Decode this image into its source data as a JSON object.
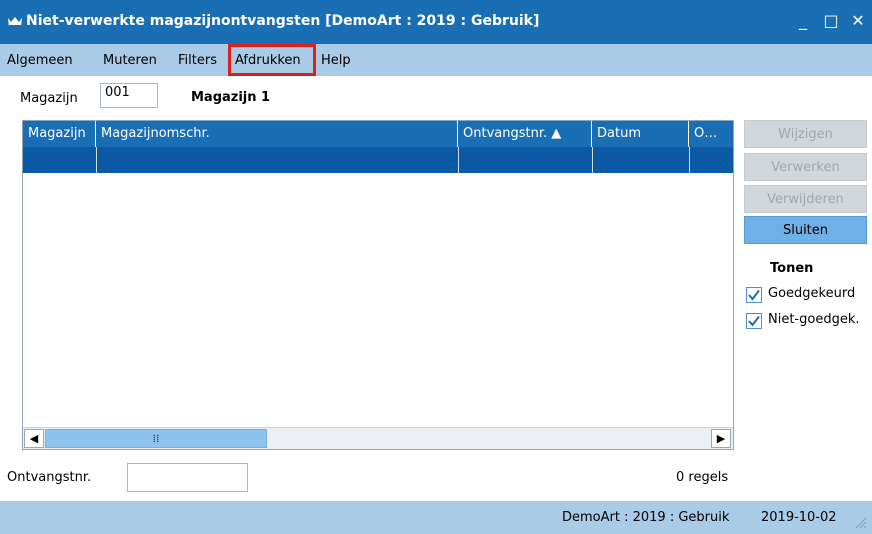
{
  "window": {
    "title": "Niet-verwerkte magazijnontvangsten  [DemoArt : 2019 : Gebruik]",
    "minimize": "_",
    "maximize": "□",
    "close": "✕"
  },
  "menu": {
    "items": [
      "Algemeen",
      "Muteren",
      "Filters",
      "Afdrukken",
      "Help"
    ],
    "highlighted": "Afdrukken"
  },
  "filter": {
    "magazijn_label": "Magazijn",
    "magazijn_value": "001",
    "magazijn_name": "Magazijn 1"
  },
  "grid": {
    "columns": [
      "Magazijn",
      "Magazijnomschr.",
      "Ontvangstnr. ▲",
      "Datum",
      "O…"
    ],
    "sort_column": "Ontvangstnr.",
    "rows": [
      [
        "",
        "",
        "",
        "",
        ""
      ]
    ],
    "scroll_thumb": "⁞⁞"
  },
  "buttons": {
    "wijzigen": "Wijzigen",
    "verwerken": "Verwerken",
    "verwijderen": "Verwijderen",
    "sluiten": "Sluiten"
  },
  "tonen": {
    "title": "Tonen",
    "options": [
      {
        "label": "Goedgekeurd",
        "checked": true
      },
      {
        "label": "Niet-goedgek.",
        "checked": true
      }
    ]
  },
  "footer": {
    "ontvangstnr_label": "Ontvangstnr.",
    "ontvangstnr_value": "",
    "regels": "0 regels"
  },
  "status": {
    "context": "DemoArt : 2019 : Gebruik",
    "date": "2019-10-02"
  },
  "colors": {
    "titlebar": "#1a6fb4",
    "menubar": "#a9cbe7",
    "selected_row": "#0c5aa6",
    "highlight_box": "#e01e1e"
  }
}
